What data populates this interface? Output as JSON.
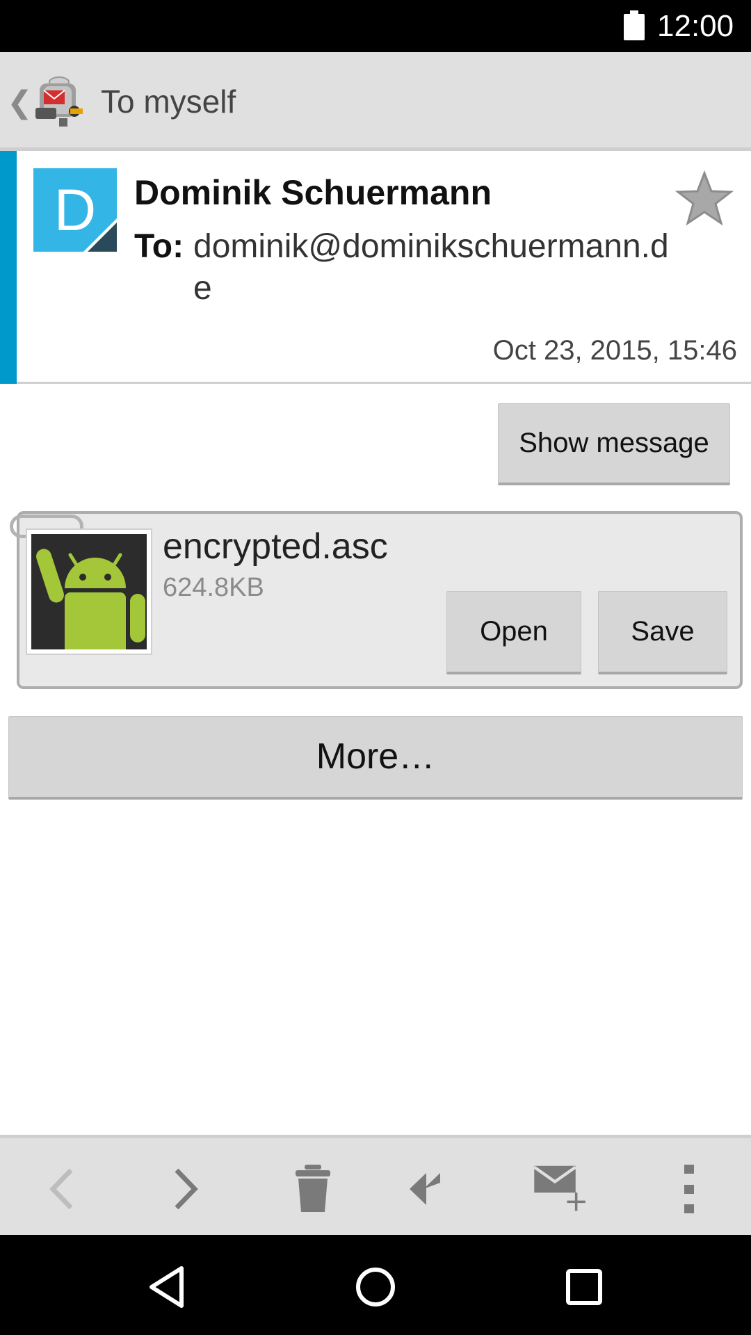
{
  "status_bar": {
    "time": "12:00"
  },
  "action_bar": {
    "title": "To myself"
  },
  "message": {
    "avatar_letter": "D",
    "sender": "Dominik Schuermann",
    "to_label": "To:",
    "to_value": "dominik@dominikschuermann.de",
    "date": "Oct 23, 2015, 15:46"
  },
  "buttons": {
    "show_message": "Show message",
    "open": "Open",
    "save": "Save",
    "more": "More…"
  },
  "attachment": {
    "name": "encrypted.asc",
    "size": "624.8KB"
  },
  "colors": {
    "accent": "#0099cc",
    "avatar": "#33b5e5",
    "android_green": "#a4c639"
  },
  "toolbar_icons": [
    "previous-icon",
    "next-icon",
    "delete-icon",
    "reply-all-icon",
    "compose-icon",
    "overflow-menu-icon"
  ],
  "nav_icons": [
    "back-icon",
    "home-icon",
    "recents-icon"
  ]
}
